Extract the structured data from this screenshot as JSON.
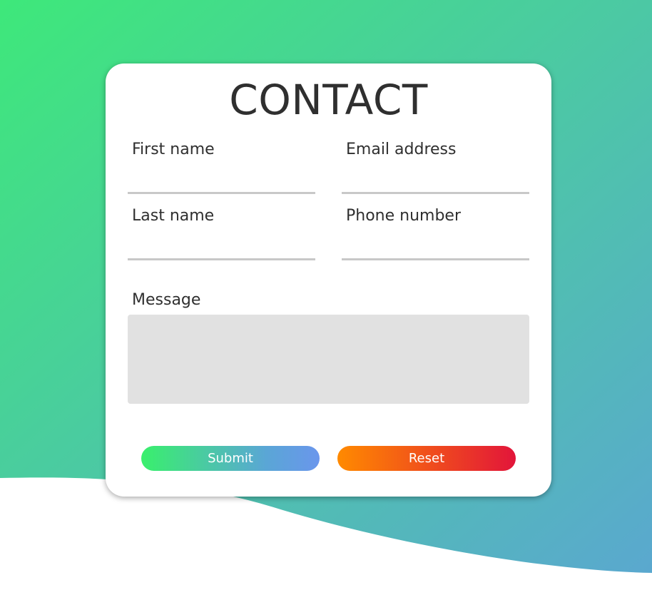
{
  "form": {
    "title": "CONTACT",
    "fields": {
      "first_name": {
        "label": "First name",
        "value": ""
      },
      "email": {
        "label": "Email address",
        "value": ""
      },
      "last_name": {
        "label": "Last name",
        "value": ""
      },
      "phone": {
        "label": "Phone number",
        "value": ""
      }
    },
    "message": {
      "label": "Message",
      "value": ""
    },
    "buttons": {
      "submit_label": "Submit",
      "reset_label": "Reset"
    }
  },
  "colors": {
    "background_gradient": [
      "#3ee87a",
      "#5aa8cf"
    ],
    "submit_gradient": [
      "#39f06c",
      "#6a96ec"
    ],
    "reset_gradient": [
      "#ff8a00",
      "#e2153a"
    ],
    "text": "#2f2f2f",
    "message_bg": "#e1e1e1",
    "underline": "#c8c8c8"
  }
}
